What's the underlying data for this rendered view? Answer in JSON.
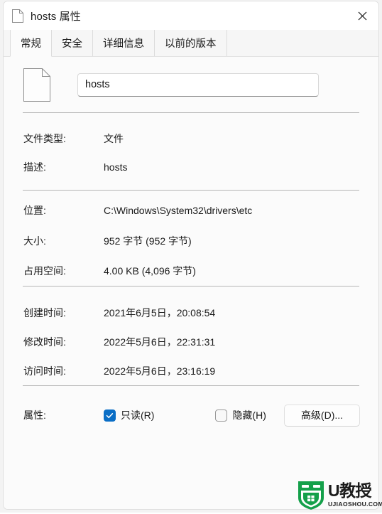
{
  "window": {
    "title": "hosts 属性",
    "title_icon": "document-icon",
    "close_label": "✕"
  },
  "tabs": [
    {
      "label": "常规",
      "active": true
    },
    {
      "label": "安全",
      "active": false
    },
    {
      "label": "详细信息",
      "active": false
    },
    {
      "label": "以前的版本",
      "active": false
    }
  ],
  "file": {
    "icon": "document-icon",
    "name_value": "hosts",
    "name_placeholder": "hosts"
  },
  "properties": [
    {
      "label": "文件类型:",
      "value": "文件"
    },
    {
      "label": "描述:",
      "value": "hosts"
    },
    {
      "label": "位置:",
      "value": "C:\\Windows\\System32\\drivers\\etc"
    },
    {
      "label": "大小:",
      "value": "952 字节 (952 字节)"
    },
    {
      "label": "占用空间:",
      "value": "4.00 KB (4,096 字节)"
    },
    {
      "label": "创建时间:",
      "value": "2021年6月5日，20:08:54"
    },
    {
      "label": "修改时间:",
      "value": "2022年5月6日，22:31:31"
    },
    {
      "label": "访问时间:",
      "value": "2022年5月6日，23:16:19"
    }
  ],
  "attributes": {
    "label": "属性:",
    "readonly": {
      "label": "只读(R)",
      "checked": true
    },
    "hidden": {
      "label": "隐藏(H)",
      "checked": false
    },
    "advanced_button": "高级(D)..."
  },
  "watermark": {
    "brand": "U教授",
    "domain": "UJIAOSHOU.COM",
    "color": "#14a04a",
    "shield_icon": "shield-windows-icon"
  },
  "colors": {
    "accent": "#0a6ec6",
    "titlebar_bg": "#ffffff",
    "body_bg": "#fbfbfb",
    "tabstrip_bg": "#f6f6f6",
    "separator": "#b5b5b5"
  }
}
